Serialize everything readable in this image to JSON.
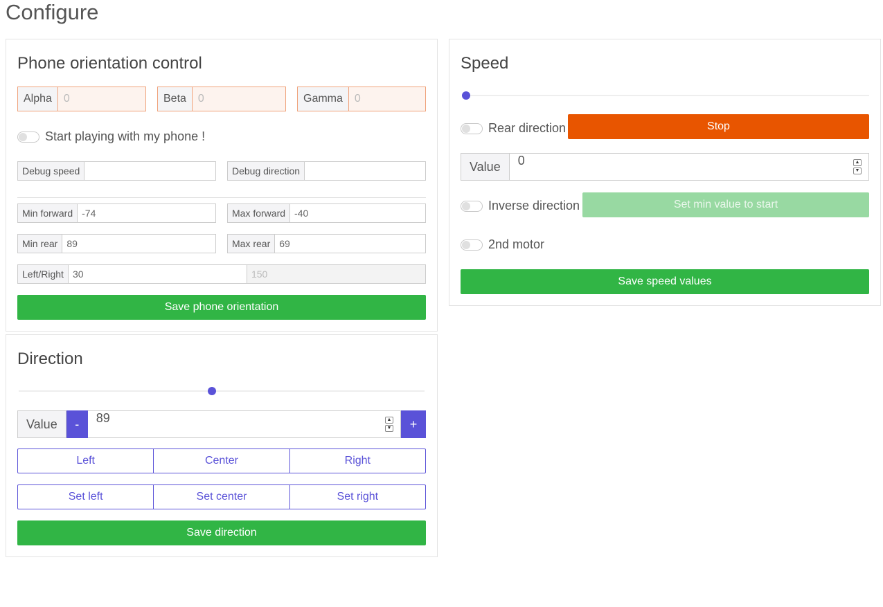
{
  "page": {
    "title": "Configure"
  },
  "orientation": {
    "title": "Phone orientation control",
    "alpha": {
      "label": "Alpha",
      "placeholder": "0"
    },
    "beta": {
      "label": "Beta",
      "placeholder": "0"
    },
    "gamma": {
      "label": "Gamma",
      "placeholder": "0"
    },
    "play_switch_label": "Start playing with my phone !",
    "debug_speed": {
      "label": "Debug speed",
      "value": ""
    },
    "debug_direction": {
      "label": "Debug direction",
      "value": ""
    },
    "min_forward": {
      "label": "Min forward",
      "value": "-74"
    },
    "max_forward": {
      "label": "Max forward",
      "value": "-40"
    },
    "min_rear": {
      "label": "Min rear",
      "value": "89"
    },
    "max_rear": {
      "label": "Max rear",
      "value": "69"
    },
    "left_right": {
      "label": "Left/Right",
      "value": "30",
      "placeholder": "150"
    },
    "save_label": "Save phone orientation"
  },
  "direction": {
    "title": "Direction",
    "slider_fraction": 0.475,
    "value_label": "Value",
    "minus_label": "-",
    "plus_label": "+",
    "value": "89",
    "buttons": [
      "Left",
      "Center",
      "Right"
    ],
    "set_buttons": [
      "Set left",
      "Set center",
      "Set right"
    ],
    "save_label": "Save direction"
  },
  "speed": {
    "title": "Speed",
    "slider_fraction": 0.0,
    "rear_switch_label": "Rear direction",
    "stop_label": "Stop",
    "value_label": "Value",
    "value": "0",
    "inverse_switch_label": "Inverse direction",
    "set_min_label": "Set min value to start",
    "second_motor_label": "2nd motor",
    "save_label": "Save speed values"
  },
  "colors": {
    "accent": "#5a52d8",
    "save_green": "#31b545",
    "stop_orange": "#e85500",
    "disabled_green": "#98d9a2"
  }
}
